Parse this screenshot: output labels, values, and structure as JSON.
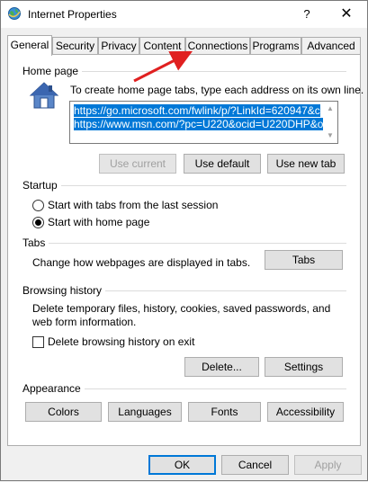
{
  "window": {
    "title": "Internet Properties",
    "help_label": "?",
    "close_label": "✕"
  },
  "tabs": [
    {
      "label": "General",
      "active": true
    },
    {
      "label": "Security",
      "active": false
    },
    {
      "label": "Privacy",
      "active": false
    },
    {
      "label": "Content",
      "active": false
    },
    {
      "label": "Connections",
      "active": false
    },
    {
      "label": "Programs",
      "active": false
    },
    {
      "label": "Advanced",
      "active": false
    }
  ],
  "home_page": {
    "heading": "Home page",
    "description": "To create home page tabs, type each address on its own line.",
    "urls": [
      "https://go.microsoft.com/fwlink/p/?LinkId=620947&c",
      "https://www.msn.com/?pc=U220&ocid=U220DHP&o"
    ],
    "use_current_label": "Use current",
    "use_default_label": "Use default",
    "use_new_tab_label": "Use new tab"
  },
  "startup": {
    "heading": "Startup",
    "option_last_session": "Start with tabs from the last session",
    "option_home_page": "Start with home page",
    "selected": "home_page"
  },
  "tabs_section": {
    "heading": "Tabs",
    "description": "Change how webpages are displayed in tabs.",
    "button_label": "Tabs"
  },
  "browsing_history": {
    "heading": "Browsing history",
    "description": "Delete temporary files, history, cookies, saved passwords, and web form information.",
    "delete_on_exit_label": "Delete browsing history on exit",
    "delete_on_exit_checked": false,
    "delete_label": "Delete...",
    "settings_label": "Settings"
  },
  "appearance": {
    "heading": "Appearance",
    "colors_label": "Colors",
    "languages_label": "Languages",
    "fonts_label": "Fonts",
    "accessibility_label": "Accessibility"
  },
  "footer": {
    "ok_label": "OK",
    "cancel_label": "Cancel",
    "apply_label": "Apply"
  },
  "annotation": {
    "arrow_color": "#e02020"
  }
}
